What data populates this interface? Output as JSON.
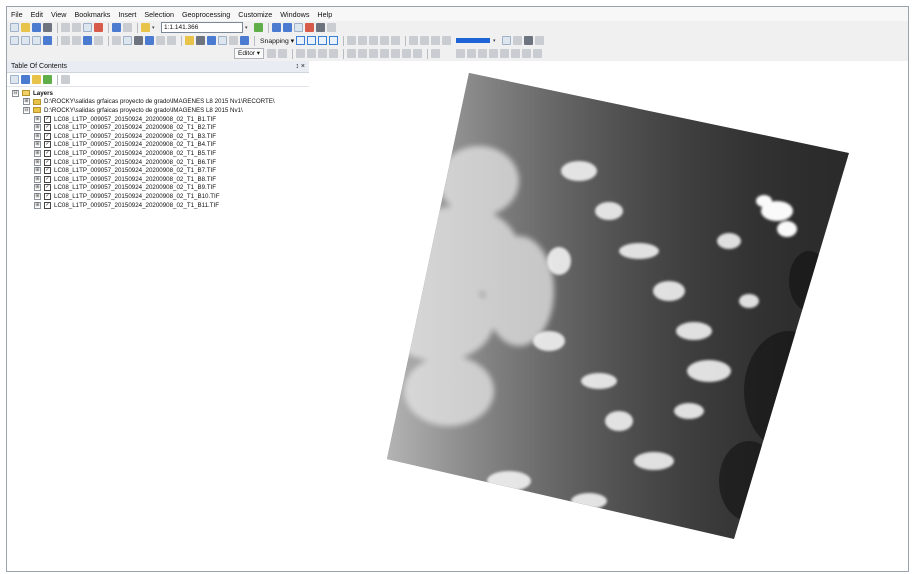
{
  "menu": [
    "File",
    "Edit",
    "View",
    "Bookmarks",
    "Insert",
    "Selection",
    "Geoprocessing",
    "Customize",
    "Windows",
    "Help"
  ],
  "toolbar": {
    "scale_value": "1:1.141.366",
    "snapping_label": "Snapping ▾",
    "editor_label": "Editor ▾"
  },
  "toc": {
    "title": "Table Of Contents",
    "pin": "↕ ×",
    "root": "Layers",
    "groups": [
      "D:\\ROCKY\\salidas grfaicas proyecto de grado\\IMAGENES L8 2015 Nv1\\RECORTE\\",
      "D:\\ROCKY\\salidas grfaicas proyecto de grado\\IMAGENES L8 2015 Nv1\\"
    ],
    "layers": [
      "LC08_L1TP_009057_20150924_20200908_02_T1_B1.TIF",
      "LC08_L1TP_009057_20150924_20200908_02_T1_B2.TIF",
      "LC08_L1TP_009057_20150924_20200908_02_T1_B3.TIF",
      "LC08_L1TP_009057_20150924_20200908_02_T1_B4.TIF",
      "LC08_L1TP_009057_20150924_20200908_02_T1_B5.TIF",
      "LC08_L1TP_009057_20150924_20200908_02_T1_B6.TIF",
      "LC08_L1TP_009057_20150924_20200908_02_T1_B7.TIF",
      "LC08_L1TP_009057_20150924_20200908_02_T1_B8.TIF",
      "LC08_L1TP_009057_20150924_20200908_02_T1_B9.TIF",
      "LC08_L1TP_009057_20150924_20200908_02_T1_B10.TIF",
      "LC08_L1TP_009057_20150924_20200908_02_T1_B11.TIF"
    ]
  },
  "icons": {
    "expand": "⊞",
    "collapse": "⊟",
    "check": "✓"
  }
}
